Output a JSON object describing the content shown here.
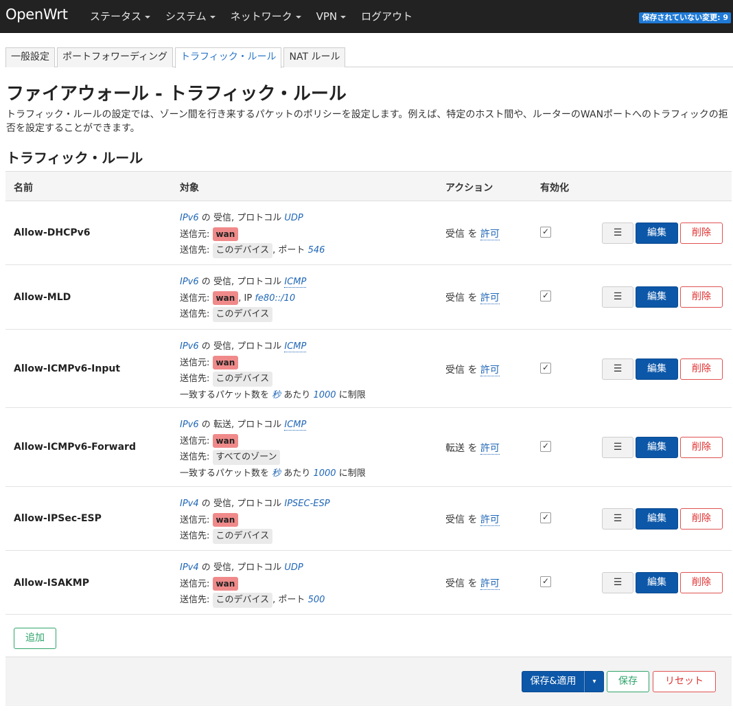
{
  "nav": {
    "brand": "OpenWrt",
    "menu": [
      {
        "label": "ステータス",
        "dropdown": true
      },
      {
        "label": "システム",
        "dropdown": true
      },
      {
        "label": "ネットワーク",
        "dropdown": true
      },
      {
        "label": "VPN",
        "dropdown": true
      },
      {
        "label": "ログアウト",
        "dropdown": false
      }
    ],
    "unsaved_badge": "保存されていない変更: 9"
  },
  "tabs": [
    {
      "label": "一般設定",
      "active": false
    },
    {
      "label": "ポートフォワーディング",
      "active": false
    },
    {
      "label": "トラフィック・ルール",
      "active": true
    },
    {
      "label": "NAT ルール",
      "active": false
    }
  ],
  "page": {
    "title": "ファイアウォール - トラフィック・ルール",
    "description": "トラフィック・ルールの設定では、ゾーン間を行き来するパケットのポリシーを設定します。例えば、特定のホスト間や、ルーターのWANポートへのトラフィックの拒否を設定することができます。",
    "section_title": "トラフィック・ルール"
  },
  "table": {
    "headers": {
      "name": "名前",
      "target": "対象",
      "action": "アクション",
      "enabled": "有効化"
    },
    "labels": {
      "of": "の",
      "proto_sep": ", プロトコル",
      "src": "送信元:",
      "dst": "送信先:",
      "port_sep": ", ポート",
      "ip_sep": ", IP",
      "limit_pre": "一致するパケット数を",
      "limit_mid": "あたり",
      "limit_post": "に制限",
      "action_wo": "を",
      "permit": "許可",
      "check": "✓",
      "more": "☰",
      "edit": "編集",
      "delete": "削除"
    },
    "rows": [
      {
        "name": "Allow-DHCPv6",
        "family": "IPv6",
        "direction": "受信",
        "proto": "UDP",
        "src_zone": "wan",
        "src_ip": "",
        "dst_zone": "このデバイス",
        "dst_port": "546",
        "limit_unit": "",
        "limit_value": "",
        "action": "受信"
      },
      {
        "name": "Allow-MLD",
        "family": "IPv6",
        "direction": "受信",
        "proto": "ICMP",
        "src_zone": "wan",
        "src_ip": "fe80::/10",
        "dst_zone": "このデバイス",
        "dst_port": "",
        "limit_unit": "",
        "limit_value": "",
        "action": "受信"
      },
      {
        "name": "Allow-ICMPv6-Input",
        "family": "IPv6",
        "direction": "受信",
        "proto": "ICMP",
        "src_zone": "wan",
        "src_ip": "",
        "dst_zone": "このデバイス",
        "dst_port": "",
        "limit_unit": "秒",
        "limit_value": "1000",
        "action": "受信"
      },
      {
        "name": "Allow-ICMPv6-Forward",
        "family": "IPv6",
        "direction": "転送",
        "proto": "ICMP",
        "src_zone": "wan",
        "src_ip": "",
        "dst_zone": "すべてのゾーン",
        "dst_port": "",
        "limit_unit": "秒",
        "limit_value": "1000",
        "action": "転送"
      },
      {
        "name": "Allow-IPSec-ESP",
        "family": "IPv4",
        "direction": "受信",
        "proto": "IPSEC-ESP",
        "src_zone": "wan",
        "src_ip": "",
        "dst_zone": "このデバイス",
        "dst_port": "",
        "limit_unit": "",
        "limit_value": "",
        "action": "受信"
      },
      {
        "name": "Allow-ISAKMP",
        "family": "IPv4",
        "direction": "受信",
        "proto": "UDP",
        "src_zone": "wan",
        "src_ip": "",
        "dst_zone": "このデバイス",
        "dst_port": "500",
        "limit_unit": "",
        "limit_value": "",
        "action": "受信"
      }
    ]
  },
  "buttons": {
    "add": "追加",
    "save_apply": "保存&適用",
    "dropdown": "▾",
    "save": "保存",
    "reset": "リセット"
  }
}
